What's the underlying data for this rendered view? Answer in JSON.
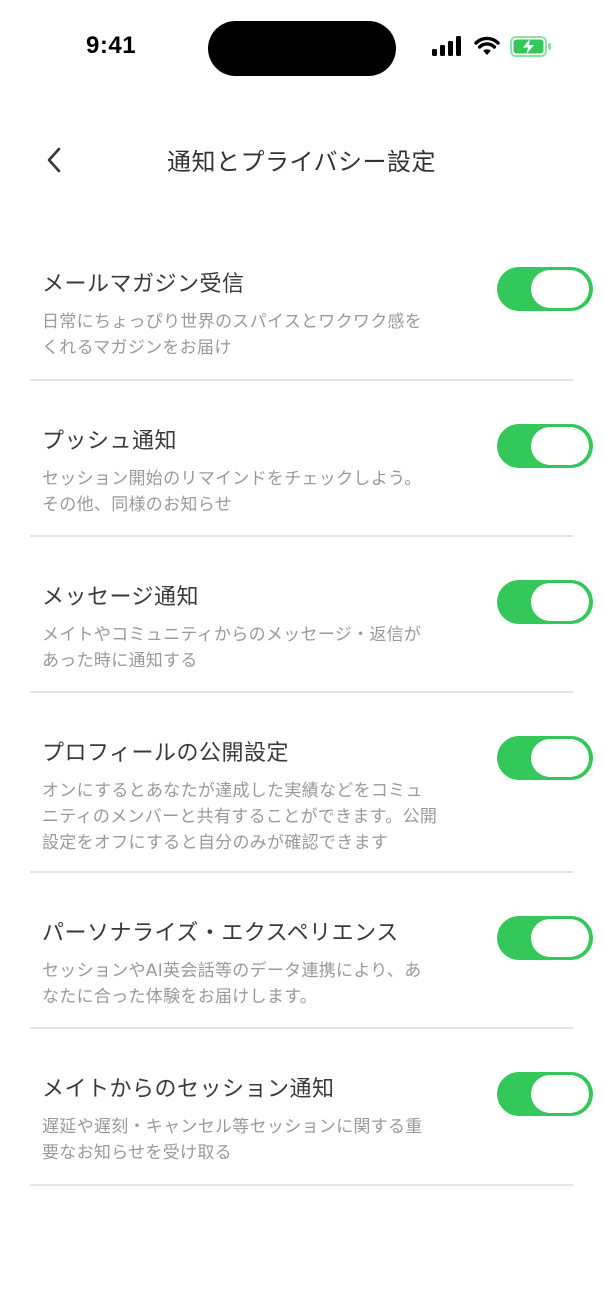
{
  "status_bar": {
    "time": "9:41",
    "icons": [
      "signal-icon",
      "wifi-icon",
      "battery-charging-icon"
    ],
    "battery_color": "#34c759"
  },
  "header": {
    "back_icon": "chevron-left-icon",
    "title": "通知とプライバシー設定"
  },
  "colors": {
    "toggle_on": "#34c759",
    "title_text": "#3a3a3a",
    "desc_text": "#9a9a9a",
    "divider": "#e6e6e6"
  },
  "settings": [
    {
      "title": "メールマガジン受信",
      "desc_lines": [
        "日常にちょっぴり世界のスパイスとワクワク感を",
        "くれるマガジンをお届け"
      ],
      "enabled": true
    },
    {
      "title": "プッシュ通知",
      "desc_lines": [
        "セッション開始のリマインドをチェックしよう。",
        "その他、同様のお知らせ"
      ],
      "enabled": true
    },
    {
      "title": "メッセージ通知",
      "desc_lines": [
        "メイトやコミュニティからのメッセージ・返信が",
        "あった時に通知する"
      ],
      "enabled": true
    },
    {
      "title": "プロフィールの公開設定",
      "desc_lines": [
        "オンにするとあなたが達成した実績などをコミュ",
        "ニティのメンバーと共有することができます。公開",
        "設定をオフにすると自分のみが確認できます"
      ],
      "enabled": true
    },
    {
      "title": "パーソナライズ・エクスペリエンス",
      "desc_lines": [
        "セッションやAI英会話等のデータ連携により、あ",
        "なたに合った体験をお届けします。"
      ],
      "enabled": true
    },
    {
      "title": "メイトからのセッション通知",
      "desc_lines": [
        "遅延や遅刻・キャンセル等セッションに関する重",
        "要なお知らせを受け取る"
      ],
      "enabled": true
    }
  ]
}
